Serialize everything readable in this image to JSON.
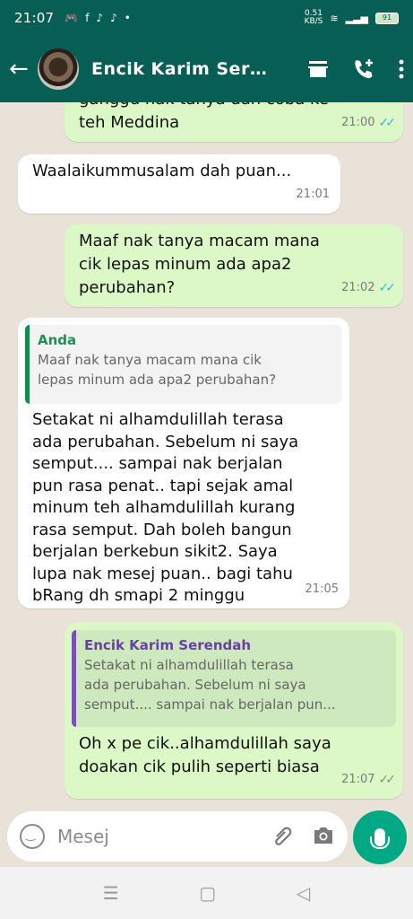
{
  "status": {
    "time": "21:07",
    "net_speed_value": "0.51",
    "net_speed_unit": "KB/S",
    "battery": "91"
  },
  "header": {
    "contact_name": "Encik Karim Serendah"
  },
  "messages": [
    {
      "type": "out",
      "text": "ganggu nak tanya dan coba ke\nteh Meddina",
      "time": "21:00",
      "status": "read"
    },
    {
      "type": "in",
      "text": "Waalaikummusalam dah puan...",
      "time": "21:01"
    },
    {
      "type": "out",
      "text": "Maaf nak tanya macam mana\ncik lepas minum ada apa2\nperubahan?",
      "time": "21:02",
      "status": "read"
    },
    {
      "type": "in",
      "quote_author": "Anda",
      "quote_text": "Maaf nak tanya macam mana cik\nlepas minum ada apa2 perubahan?",
      "text": "Setakat ni alhamdulillah terasa\nada perubahan. Sebelum ni saya\nsemput.... sampai nak berjalan\npun rasa penat.. tapi sejak amal\nminum teh alhamdulillah kurang\nrasa semput. Dah boleh bangun\nberjalan berkebun sikit2. Saya\nlupa nak mesej puan.. bagi tahu\nbRang dh smapi 2 minggu",
      "time": "21:05"
    },
    {
      "type": "out",
      "quote_author": "Encik Karim Serendah",
      "quote_text": "Setakat ni alhamdulillah terasa\nada perubahan. Sebelum ni saya\nsemput.... sampai nak berjalan pun...",
      "text": "Oh x pe cik..alhamdulillah saya\ndoakan cik pulih seperti biasa",
      "time": "21:07",
      "status": "delivered"
    }
  ],
  "input": {
    "placeholder": "Mesej"
  }
}
